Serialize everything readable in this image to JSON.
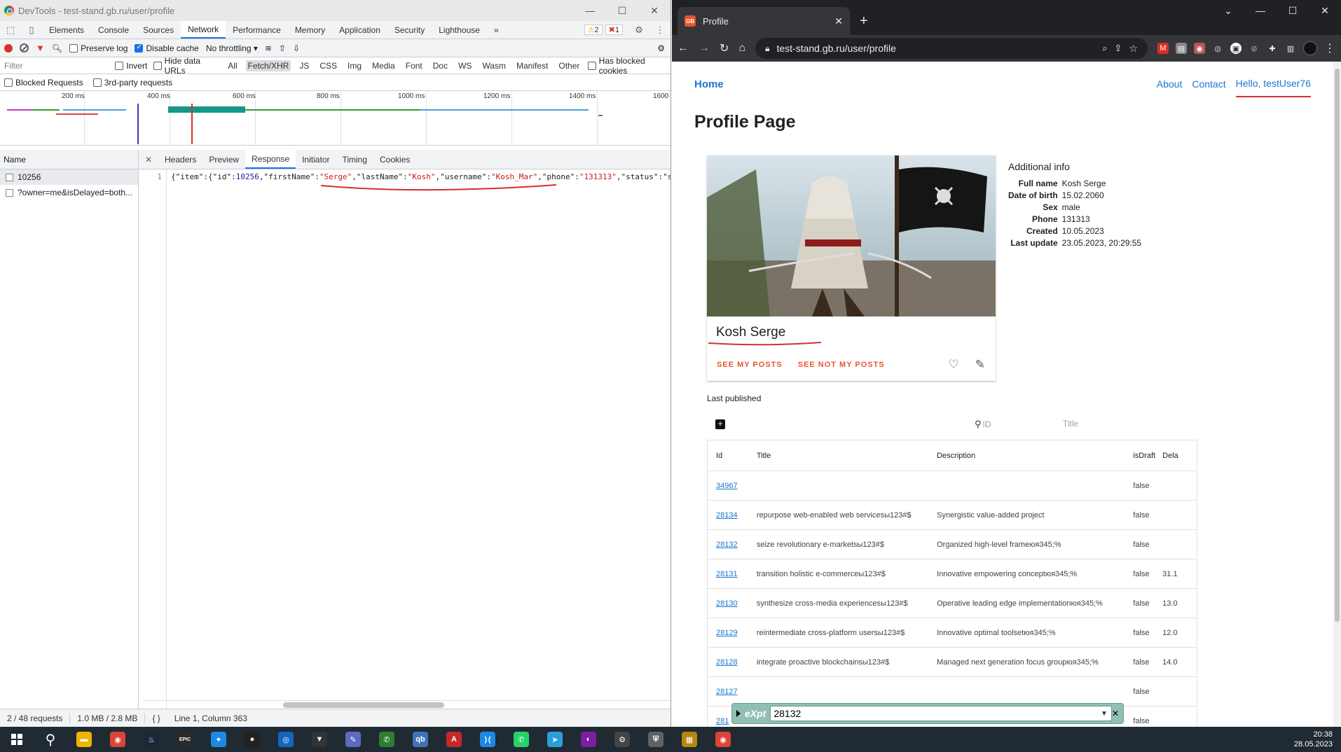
{
  "devtools": {
    "window_title": "DevTools - test-stand.gb.ru/user/profile",
    "tabs": [
      "Elements",
      "Console",
      "Sources",
      "Network",
      "Performance",
      "Memory",
      "Application",
      "Security",
      "Lighthouse"
    ],
    "active_tab": "Network",
    "more_tabs": "»",
    "warnings_count": "2",
    "errors_count": "1",
    "toolbar": {
      "preserve_log": "Preserve log",
      "disable_cache": "Disable cache",
      "throttling": "No throttling"
    },
    "filter_placeholder": "Filter",
    "filter_options": {
      "invert": "Invert",
      "hide_data_urls": "Hide data URLs",
      "types": [
        "All",
        "Fetch/XHR",
        "JS",
        "CSS",
        "Img",
        "Media",
        "Font",
        "Doc",
        "WS",
        "Wasm",
        "Manifest",
        "Other"
      ],
      "active_type": "Fetch/XHR",
      "has_blocked_cookies": "Has blocked cookies",
      "blocked_requests": "Blocked Requests",
      "third_party": "3rd-party requests"
    },
    "timeline_ticks": [
      "200 ms",
      "400 ms",
      "600 ms",
      "800 ms",
      "1000 ms",
      "1200 ms",
      "1400 ms",
      "1600"
    ],
    "request_list": {
      "header": "Name",
      "items": [
        "10256",
        "?owner=me&isDelayed=both..."
      ]
    },
    "detail_tabs": [
      "Headers",
      "Preview",
      "Response",
      "Initiator",
      "Timing",
      "Cookies"
    ],
    "active_detail_tab": "Response",
    "response": {
      "line_number": "1",
      "parts": [
        {
          "t": "p",
          "v": "{\"item\":{\"id\":"
        },
        {
          "t": "n",
          "v": "10256"
        },
        {
          "t": "p",
          "v": ",\"firstName\":"
        },
        {
          "t": "s",
          "v": "\"Serge\""
        },
        {
          "t": "p",
          "v": ",\"lastName\":"
        },
        {
          "t": "s",
          "v": "\"Kosh\""
        },
        {
          "t": "p",
          "v": ",\"username\":"
        },
        {
          "t": "s",
          "v": "\"Kosh_Mar\""
        },
        {
          "t": "p",
          "v": ",\"phone\":"
        },
        {
          "t": "s",
          "v": "\"131313\""
        },
        {
          "t": "p",
          "v": ",\"status\":\"s"
        }
      ]
    },
    "status": {
      "requests": "2 / 48 requests",
      "size": "1.0 MB / 2.8 MB",
      "braces": "{ }",
      "position": "Line 1, Column 363"
    }
  },
  "browser": {
    "tab_title": "Profile",
    "url": "test-stand.gb.ru/user/profile",
    "nav": {
      "home": "Home",
      "about": "About",
      "contact": "Contact",
      "user": "Hello, testUser76"
    },
    "page_title": "Profile Page",
    "profile": {
      "name": "Kosh Serge",
      "see_my_posts": "SEE MY POSTS",
      "see_not_my_posts": "SEE NOT MY POSTS"
    },
    "additional_info": {
      "title": "Additional info",
      "rows": [
        {
          "k": "Full name",
          "v": "Kosh Serge"
        },
        {
          "k": "Date of birth",
          "v": "15.02.2060"
        },
        {
          "k": "Sex",
          "v": "male"
        },
        {
          "k": "Phone",
          "v": "131313"
        },
        {
          "k": "Created",
          "v": "10.05.2023"
        },
        {
          "k": "Last update",
          "v": "23.05.2023, 20:29:55"
        }
      ]
    },
    "last_published": "Last published",
    "search_id_placeholder": "ID",
    "search_title_placeholder": "Title",
    "posts": {
      "columns": [
        "Id",
        "Title",
        "Description",
        "isDraft",
        "Dela"
      ],
      "rows": [
        {
          "id": "34967",
          "title": "",
          "desc": "",
          "draft": "false",
          "del": ""
        },
        {
          "id": "28134",
          "title": "repurpose web-enabled web servicesы123#$",
          "desc": "Synergistic value-added project",
          "draft": "false",
          "del": ""
        },
        {
          "id": "28132",
          "title": "seize revolutionary e-marketsы123#$",
          "desc": "Organized high-level frameюя345;%",
          "draft": "false",
          "del": ""
        },
        {
          "id": "28131",
          "title": "transition holistic e-commerceы123#$",
          "desc": "Innovative empowering conceptюя345;%",
          "draft": "false",
          "del": "31.1"
        },
        {
          "id": "28130",
          "title": "synthesize cross-media experiencesы123#$",
          "desc": "Operative leading edge implementationюя345;%",
          "draft": "false",
          "del": "13.0"
        },
        {
          "id": "28129",
          "title": "reintermediate cross-platform usersы123#$",
          "desc": "Innovative optimal toolsetюя345;%",
          "draft": "false",
          "del": "12.0"
        },
        {
          "id": "28128",
          "title": "integrate proactive blockchainsы123#$",
          "desc": "Managed next generation focus groupюя345;%",
          "draft": "false",
          "del": "14.0"
        },
        {
          "id": "28127",
          "title": "",
          "desc": "",
          "draft": "false",
          "del": ""
        },
        {
          "id": "281",
          "title": "",
          "desc": "",
          "draft": "false",
          "del": ""
        }
      ]
    }
  },
  "expt_bar": {
    "label": "eXpt",
    "value": "28132"
  },
  "taskbar": {
    "time": "20:38",
    "date": "28.05.2023",
    "apps": [
      {
        "name": "file-explorer-icon",
        "color": "#f0b400",
        "glyph": "▬"
      },
      {
        "name": "chrome-icon",
        "color": "#db4437",
        "glyph": "◉"
      },
      {
        "name": "steam-icon",
        "color": "#1b2838",
        "glyph": "♨"
      },
      {
        "name": "epic-games-icon",
        "color": "#2a2a2a",
        "glyph": "EPIC"
      },
      {
        "name": "battlenet-icon",
        "color": "#1e88e5",
        "glyph": "✦"
      },
      {
        "name": "obs-icon",
        "color": "#222",
        "glyph": "●"
      },
      {
        "name": "ubisoft-icon",
        "color": "#1565c0",
        "glyph": "◎"
      },
      {
        "name": "fox-icon",
        "color": "#333",
        "glyph": "▼"
      },
      {
        "name": "feather-icon",
        "color": "#5c6bc0",
        "glyph": "✎"
      },
      {
        "name": "phone-app-icon",
        "color": "#2e7d32",
        "glyph": "✆"
      },
      {
        "name": "qbittorrent-icon",
        "color": "#3e73b8",
        "glyph": "qb"
      },
      {
        "name": "acrobat-icon",
        "color": "#c62828",
        "glyph": "A"
      },
      {
        "name": "vscode-icon",
        "color": "#1e88e5",
        "glyph": "⟩⟨"
      },
      {
        "name": "whatsapp-icon",
        "color": "#25d366",
        "glyph": "✆"
      },
      {
        "name": "telegram-icon",
        "color": "#2aa0da",
        "glyph": "➤"
      },
      {
        "name": "podcast-icon",
        "color": "#7b1fa2",
        "glyph": "◐"
      },
      {
        "name": "settings-icon",
        "color": "#444",
        "glyph": "⚙"
      },
      {
        "name": "shield-app-icon",
        "color": "#616161",
        "glyph": "⛨"
      },
      {
        "name": "archive-icon",
        "color": "#b8860b",
        "glyph": "▦"
      },
      {
        "name": "chrome-2-icon",
        "color": "#db4437",
        "glyph": "◉"
      }
    ]
  },
  "colors": {
    "accent": "#1a73e8",
    "link": "#1976d2",
    "action": "#e8542e",
    "underline": "#d32f2f",
    "json_string": "#c41a16",
    "json_number": "#1a1aa6"
  }
}
